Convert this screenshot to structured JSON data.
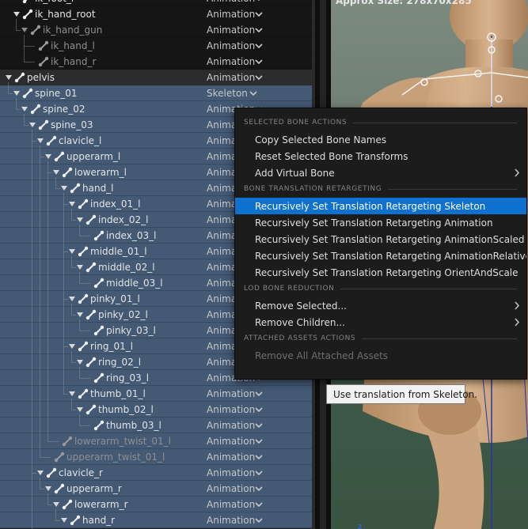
{
  "tree": {
    "rows": [
      {
        "name": "ik_foot_r",
        "mode": "Animation"
      },
      {
        "name": "ik_hand_root",
        "mode": "Animation"
      },
      {
        "name": "ik_hand_gun",
        "mode": "Animation"
      },
      {
        "name": "ik_hand_l",
        "mode": "Animation"
      },
      {
        "name": "ik_hand_r",
        "mode": "Animation"
      },
      {
        "name": "pelvis",
        "mode": "Animation"
      },
      {
        "name": "spine_01",
        "mode": "Skeleton"
      },
      {
        "name": "spine_02",
        "mode": "Animation"
      },
      {
        "name": "spine_03",
        "mode": "Animation"
      },
      {
        "name": "clavicle_l",
        "mode": "Animation"
      },
      {
        "name": "upperarm_l",
        "mode": "Animation"
      },
      {
        "name": "lowerarm_l",
        "mode": "Animation"
      },
      {
        "name": "hand_l",
        "mode": "Animation"
      },
      {
        "name": "index_01_l",
        "mode": "Animation"
      },
      {
        "name": "index_02_l",
        "mode": "Animation"
      },
      {
        "name": "index_03_l",
        "mode": "Animation"
      },
      {
        "name": "middle_01_l",
        "mode": "Animation"
      },
      {
        "name": "middle_02_l",
        "mode": "Animation"
      },
      {
        "name": "middle_03_l",
        "mode": "Animation"
      },
      {
        "name": "pinky_01_l",
        "mode": "Animation"
      },
      {
        "name": "pinky_02_l",
        "mode": "Animation"
      },
      {
        "name": "pinky_03_l",
        "mode": "Animation"
      },
      {
        "name": "ring_01_l",
        "mode": "Animation"
      },
      {
        "name": "ring_02_l",
        "mode": "Animation"
      },
      {
        "name": "ring_03_l",
        "mode": "Animation"
      },
      {
        "name": "thumb_01_l",
        "mode": "Animation"
      },
      {
        "name": "thumb_02_l",
        "mode": "Animation"
      },
      {
        "name": "thumb_03_l",
        "mode": "Animation"
      },
      {
        "name": "lowerarm_twist_01_l",
        "mode": "Animation"
      },
      {
        "name": "upperarm_twist_01_l",
        "mode": "Animation"
      },
      {
        "name": "clavicle_r",
        "mode": "Animation"
      },
      {
        "name": "upperarm_r",
        "mode": "Animation"
      },
      {
        "name": "lowerarm_r",
        "mode": "Animation"
      },
      {
        "name": "hand_r",
        "mode": "Animation"
      }
    ]
  },
  "viewport": {
    "info": "Approx Size: 278x70x285"
  },
  "context_menu": {
    "sections": [
      {
        "header": "SELECTED BONE ACTIONS",
        "items": [
          {
            "label": "Copy Selected Bone Names"
          },
          {
            "label": "Reset Selected Bone Transforms"
          },
          {
            "label": "Add Virtual Bone",
            "submenu": true
          }
        ]
      },
      {
        "header": "BONE TRANSLATION RETARGETING",
        "items": [
          {
            "label": "Recursively Set Translation Retargeting Skeleton",
            "highlighted": true
          },
          {
            "label": "Recursively Set Translation Retargeting Animation"
          },
          {
            "label": "Recursively Set Translation Retargeting AnimationScaled"
          },
          {
            "label": "Recursively Set Translation Retargeting AnimationRelative"
          },
          {
            "label": "Recursively Set Translation Retargeting OrientAndScale"
          }
        ]
      },
      {
        "header": "LOD BONE REDUCTION",
        "items": [
          {
            "label": "Remove Selected...",
            "submenu": true
          },
          {
            "label": "Remove Children...",
            "submenu": true
          }
        ]
      },
      {
        "header": "ATTACHED ASSETS ACTIONS",
        "items": [
          {
            "label": "Remove All Attached Assets",
            "disabled": true
          }
        ]
      }
    ]
  },
  "tooltip": {
    "text": "Use translation from Skeleton."
  },
  "colors": {
    "selected_row": "#435974",
    "menu_highlight": "#0e71cf",
    "menu_bg": "#1c1c1c",
    "tooltip_bg": "#f2f2f2"
  }
}
